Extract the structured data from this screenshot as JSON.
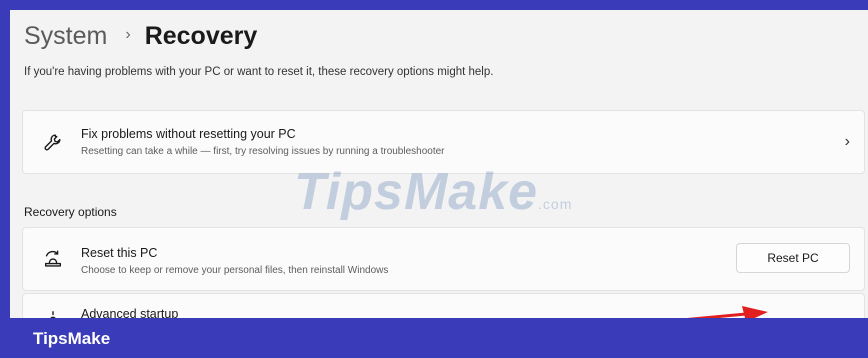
{
  "header": {
    "breadcrumb_parent": "System",
    "breadcrumb_separator": "›",
    "breadcrumb_current": "Recovery",
    "intro": "If you're having problems with your PC or want to reset it, these recovery options might help."
  },
  "fix_card": {
    "icon": "wrench-icon",
    "title": "Fix problems without resetting your PC",
    "description": "Resetting can take a while — first, try resolving issues by running a troubleshooter",
    "chevron": "›"
  },
  "recovery_options": {
    "section_title": "Recovery options",
    "reset": {
      "icon": "reset-pc-icon",
      "title": "Reset this PC",
      "description": "Choose to keep or remove your personal files, then reinstall Windows",
      "button_label": "Reset PC"
    },
    "advanced": {
      "icon": "advanced-startup-icon",
      "title": "Advanced startup"
    }
  },
  "watermark": {
    "text": "TipsMake",
    "suffix": ".com"
  },
  "footer": {
    "brand": "TipsMake"
  },
  "colors": {
    "frame": "#3a3bb8",
    "window_bg": "#f3f3f3",
    "card_bg": "#fbfbfb",
    "annotation_arrow": "#e02020"
  }
}
